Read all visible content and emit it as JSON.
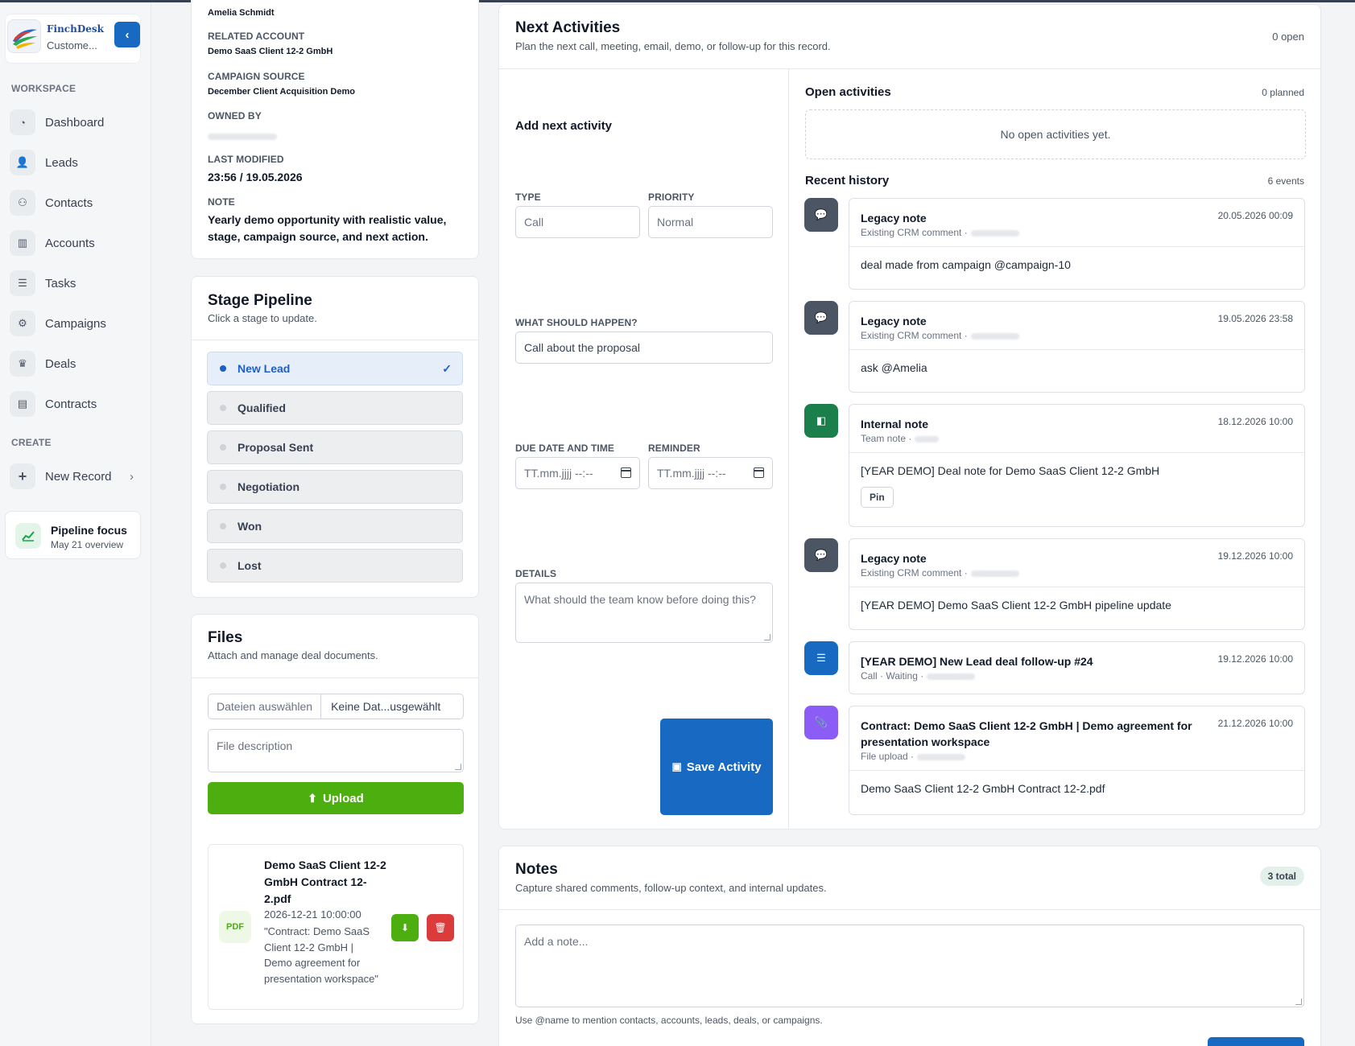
{
  "brand": {
    "name": "FinchDesk",
    "subtitle": "Custome..."
  },
  "sidebar": {
    "workspace_label": "WORKSPACE",
    "items": [
      {
        "label": "Dashboard",
        "icon": "gauge-icon"
      },
      {
        "label": "Leads",
        "icon": "user-plus-icon"
      },
      {
        "label": "Contacts",
        "icon": "users-icon"
      },
      {
        "label": "Accounts",
        "icon": "building-icon"
      },
      {
        "label": "Tasks",
        "icon": "list-icon"
      },
      {
        "label": "Campaigns",
        "icon": "campaign-icon"
      },
      {
        "label": "Deals",
        "icon": "trophy-icon"
      },
      {
        "label": "Contracts",
        "icon": "document-icon"
      }
    ],
    "create_label": "CREATE",
    "new_record": "New Record",
    "focus": {
      "title": "Pipeline focus",
      "subtitle": "May 21 overview"
    }
  },
  "details": {
    "contact": "Amelia Schmidt",
    "related_account_label": "RELATED ACCOUNT",
    "related_account": "Demo SaaS Client 12-2 GmbH",
    "campaign_source_label": "CAMPAIGN SOURCE",
    "campaign_source": "December Client Acquisition Demo",
    "owned_by_label": "OWNED BY",
    "last_modified_label": "LAST MODIFIED",
    "last_modified": "23:56 / 19.05.2026",
    "note_label": "NOTE",
    "note": "Yearly demo opportunity with realistic value, stage, campaign source, and next action."
  },
  "pipeline": {
    "title": "Stage Pipeline",
    "subtitle": "Click a stage to update.",
    "stages": [
      "New Lead",
      "Qualified",
      "Proposal Sent",
      "Negotiation",
      "Won",
      "Lost"
    ],
    "active": "New Lead"
  },
  "files": {
    "title": "Files",
    "subtitle": "Attach and manage deal documents.",
    "choose_button": "Dateien auswählen",
    "no_file": "Keine Dat...usgewählt",
    "description_placeholder": "File description",
    "upload": "Upload",
    "item": {
      "type": "PDF",
      "name": "Demo SaaS Client 12-2 GmbH Contract 12-2.pdf",
      "date": "2026-12-21 10:00:00",
      "description": "\"Contract: Demo SaaS Client 12-2 GmbH | Demo agreement for presentation workspace\""
    }
  },
  "activities": {
    "title": "Next Activities",
    "subtitle": "Plan the next call, meeting, email, demo, or follow-up for this record.",
    "open_count": "0 open",
    "form": {
      "heading": "Add next activity",
      "type_label": "TYPE",
      "type_value": "Call",
      "priority_label": "PRIORITY",
      "priority_value": "Normal",
      "what_label": "WHAT SHOULD HAPPEN?",
      "what_value": "Call about the proposal",
      "due_label": "DUE DATE AND TIME",
      "due_placeholder": "TT.mm.jjjj --:--",
      "reminder_label": "REMINDER",
      "reminder_placeholder": "TT.mm.jjjj --:--",
      "details_label": "DETAILS",
      "details_placeholder": "What should the team know before doing this?",
      "save": "Save Activity"
    },
    "open": {
      "title": "Open activities",
      "count": "0 planned",
      "empty": "No open activities yet."
    },
    "history": {
      "title": "Recent history",
      "count": "6 events",
      "events": [
        {
          "title": "Legacy note",
          "meta": "Existing CRM comment ·",
          "date": "20.05.2026 00:09",
          "body": "deal made from campaign @campaign-10",
          "icon": "comment-icon",
          "color": "#4b5563"
        },
        {
          "title": "Legacy note",
          "meta": "Existing CRM comment ·",
          "date": "19.05.2026 23:58",
          "body": "ask @Amelia",
          "icon": "comment-icon",
          "color": "#4b5563"
        },
        {
          "title": "Internal note",
          "meta": "Team note ·",
          "date": "18.12.2026 10:00",
          "body": "[YEAR DEMO] Deal note for Demo SaaS Client 12-2 GmbH",
          "pin": "Pin",
          "icon": "sticky-note-icon",
          "color": "#1a7f4b"
        },
        {
          "title": "Legacy note",
          "meta": "Existing CRM comment ·",
          "date": "19.12.2026 10:00",
          "body": "[YEAR DEMO] Demo SaaS Client 12-2 GmbH pipeline update",
          "icon": "comment-icon",
          "color": "#4b5563"
        },
        {
          "title": "[YEAR DEMO] New Lead deal follow-up #24",
          "meta": "Call · Waiting ·",
          "date": "19.12.2026 10:00",
          "icon": "task-icon",
          "color": "#1769c2"
        },
        {
          "title": "Contract: Demo SaaS Client 12-2 GmbH | Demo agreement for presentation workspace",
          "meta": "File upload ·",
          "date": "21.12.2026 10:00",
          "body": "Demo SaaS Client 12-2 GmbH Contract 12-2.pdf",
          "icon": "paperclip-icon",
          "color": "#8b5cf6"
        }
      ]
    }
  },
  "notes": {
    "title": "Notes",
    "subtitle": "Capture shared comments, follow-up context, and internal updates.",
    "count": "3 total",
    "placeholder": "Add a note...",
    "hint": "Use @name to mention contacts, accounts, leads, deals, or campaigns."
  }
}
